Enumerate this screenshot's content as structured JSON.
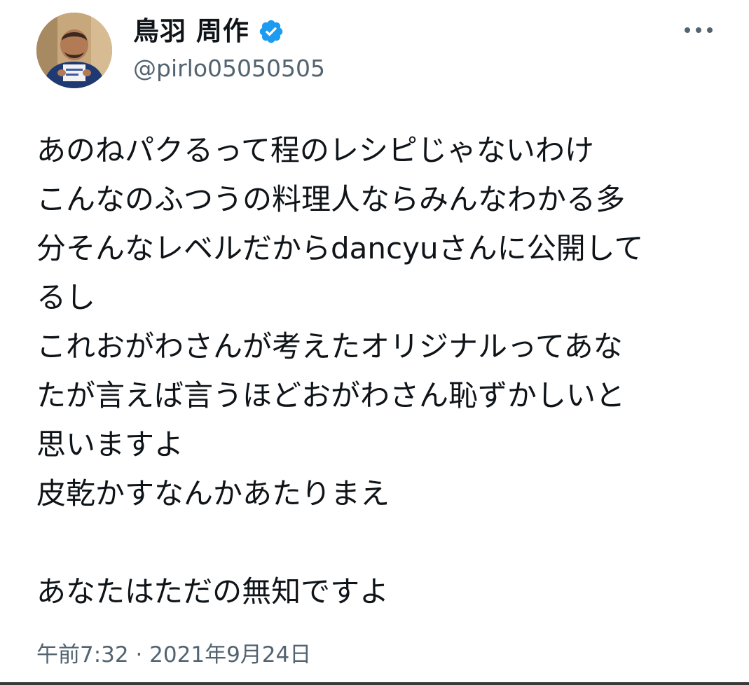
{
  "user": {
    "display_name": "鳥羽 周作",
    "handle": "@pirlo05050505",
    "verified": true,
    "avatar_icon": "profile-photo-avatar"
  },
  "tweet": {
    "lines": [
      "あのねパクるって程のレシピじゃないわけ",
      "こんなのふつうの料理人ならみんなわかる多",
      "分そんなレベルだからdancyuさんに公開して",
      "るし",
      "これおがわさんが考えたオリジナルってあな",
      "たが言えば言うほどおがわさん恥ずかしいと",
      "思いますよ",
      "皮乾かすなんかあたりまえ",
      "",
      "あなたはただの無知ですよ"
    ]
  },
  "meta": {
    "timestamp": "午前7:32 · 2021年9月24日"
  },
  "icons": {
    "verified": "verified-badge-icon",
    "more": "more-options-icon"
  },
  "colors": {
    "verified_blue": "#1d9bf0",
    "text_primary": "#0f1419",
    "text_secondary": "#536471"
  }
}
